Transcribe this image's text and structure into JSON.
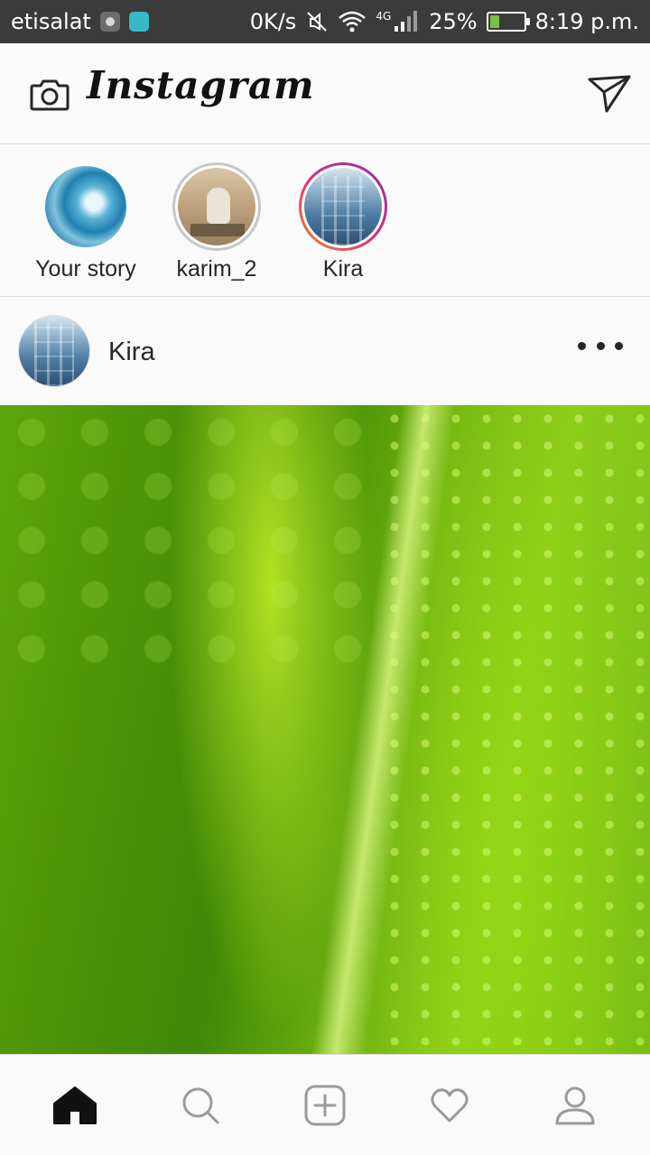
{
  "status_bar": {
    "carrier": "etisalat",
    "net_speed": "0K/s",
    "network_type": "4G",
    "battery_percent": "25%",
    "battery_level": 0.25,
    "time": "8:19 p.m."
  },
  "header": {
    "logo_text": "Instagram"
  },
  "stories": [
    {
      "label": "Your story"
    },
    {
      "label": "karim_2"
    },
    {
      "label": "Kira"
    }
  ],
  "post": {
    "username": "Kira"
  },
  "colors": {
    "story_ring_gradient": [
      "#f58529",
      "#dd2a7b",
      "#8134af"
    ],
    "seen_ring": "#c7c7c7"
  }
}
